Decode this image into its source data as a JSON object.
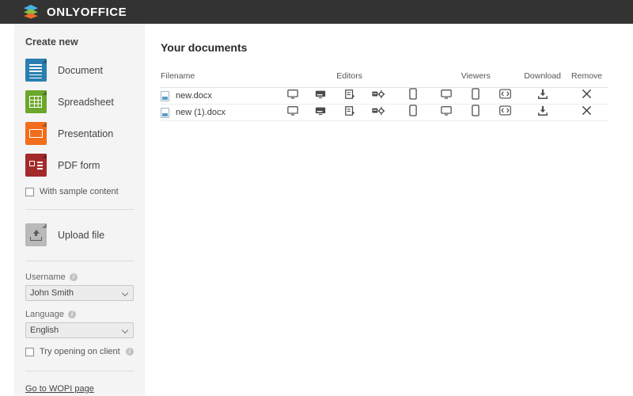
{
  "header": {
    "brand": "ONLYOFFICE",
    "logo_colors": [
      "#45b1e8",
      "#8fbf3f",
      "#ef6c28"
    ],
    "background": "#333333"
  },
  "sidebar": {
    "create_title": "Create new",
    "create_items": [
      {
        "label": "Document",
        "icon": "document-icon",
        "color": "#2a7fb0"
      },
      {
        "label": "Spreadsheet",
        "icon": "spreadsheet-icon",
        "color": "#6ba72a"
      },
      {
        "label": "Presentation",
        "icon": "presentation-icon",
        "color": "#f26d1c"
      },
      {
        "label": "PDF form",
        "icon": "pdf-form-icon",
        "color": "#a32a2a"
      }
    ],
    "sample_checkbox": {
      "label": "With sample content",
      "checked": false
    },
    "upload": {
      "label": "Upload file",
      "icon": "upload-file-icon"
    },
    "username_field": {
      "label": "Username",
      "value": "John Smith",
      "info": "i"
    },
    "language_field": {
      "label": "Language",
      "value": "English",
      "info": "i"
    },
    "client_checkbox": {
      "label": "Try opening on client",
      "checked": false,
      "info": "i"
    },
    "wopi_link": "Go to WOPI page"
  },
  "main": {
    "title": "Your documents",
    "columns": {
      "filename": "Filename",
      "editors": "Editors",
      "viewers": "Viewers",
      "download": "Download",
      "remove": "Remove"
    },
    "rows": [
      {
        "filename": "new.docx"
      },
      {
        "filename": "new (1).docx"
      }
    ],
    "editor_icons": [
      "desktop-icon",
      "embedded-icon",
      "edit-form-icon",
      "customize-gear-icon",
      "mobile-icon"
    ],
    "viewer_icons": [
      "desktop-icon",
      "mobile-icon",
      "code-embed-icon"
    ],
    "download_icon": "download-icon",
    "remove_icon": "close-icon"
  }
}
